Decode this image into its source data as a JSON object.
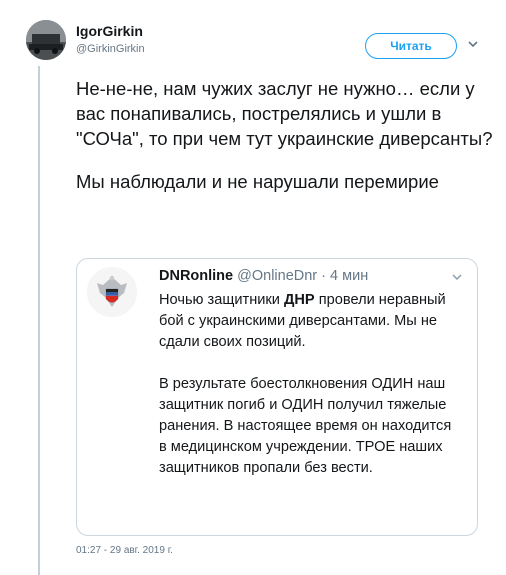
{
  "author": {
    "name": "IgorGirkin",
    "handle": "@GirkinGirkin"
  },
  "follow_button": {
    "label": "Читать"
  },
  "tweet": {
    "paragraph1": "Не-не-не, нам чужих заслуг не нужно… если у вас понапивались, постреляlись и ушли в \"СОЧа\", то при чем тут украинские диверсанты?",
    "paragraph2": "Мы наблюдали и не нарушали перемирие"
  },
  "quoted": {
    "name": "DNRonline",
    "handle": "@OnlineDnr",
    "separator": " · ",
    "time": "4 мин",
    "p1_before": "Ночью защитники ",
    "p1_bold": "ДНР",
    "p1_after": " провели неравный бой с украинскими диверсантами. Мы не сдали своих позиций.",
    "p2": "В результате боестолкновения ОДИН наш защитник погиб и ОДИН получил тяжелые ранения. В настоящее время он находится в медицинском учреждении. ТРОЕ наших защитников пропали без вести."
  },
  "timestamp": "01:27 - 29 авг. 2019 г.",
  "colors": {
    "accent": "#1da1f2",
    "muted": "#657786",
    "border": "#ccd6dd"
  },
  "icons": {
    "caret": "chevron-down-icon",
    "quoted_avatar": "dpr-coat-of-arms-logo"
  }
}
